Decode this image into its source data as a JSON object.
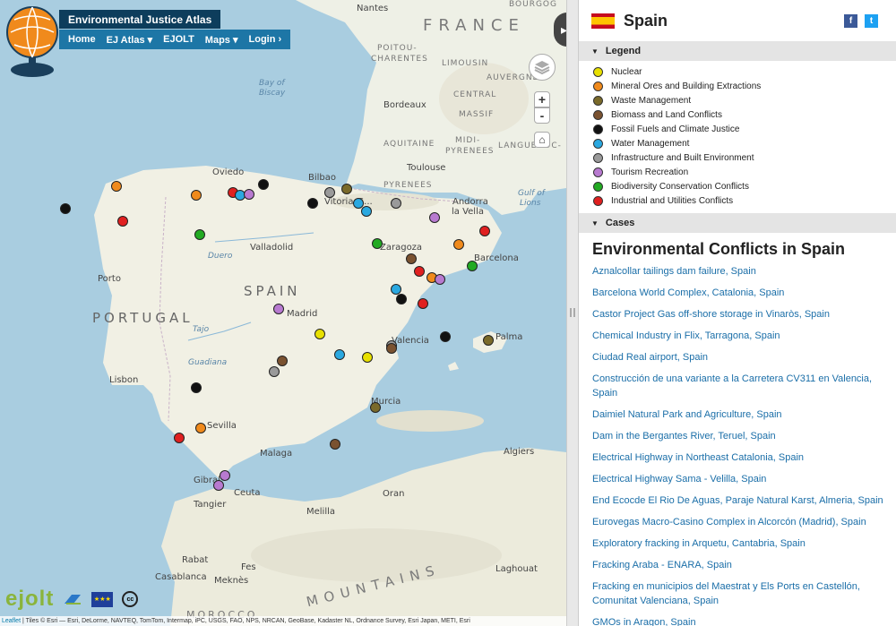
{
  "header": {
    "site_title": "Environmental Justice Atlas",
    "nav": [
      "Home",
      "EJ Atlas ▾",
      "EJOLT",
      "Maps ▾",
      "Login ›"
    ]
  },
  "map": {
    "labels": {
      "nantes": "Nantes",
      "france": "FRANCE",
      "poitou": "POITOU-",
      "charentes": "CHARENTES",
      "limousin": "LIMOUSIN",
      "auvergne": "AUVERGNE",
      "bay": "Bay of",
      "biscay": "Biscay",
      "central": "CENTRAL",
      "massif": "MASSIF",
      "bordeaux": "Bordeaux",
      "aquitaine": "AQUITAINE",
      "midi": "MIDI-",
      "pyrenees_r": "PYRENEES",
      "languedoc": "LANGUEDOC-",
      "toulouse": "Toulouse",
      "oviedo": "Oviedo",
      "bilbao": "Bilbao",
      "vitoria": "Vitoria-G...",
      "pyrenees": "PYRENEES",
      "andorra": "Andorra",
      "la_vella": "la Vella",
      "gulf": "Gulf of",
      "lions": "Lions",
      "zaragoza": "Zaragoza",
      "valladolid": "Valladolid",
      "barcelona": "Barcelona",
      "duero": "Duero",
      "porto": "Porto",
      "spain": "SPAIN",
      "portugal": "PORTUGAL",
      "madrid": "Madrid",
      "tajo": "Tajo",
      "valencia": "Valencia",
      "lisbon": "Lisbon",
      "guadiana": "Guadiana",
      "palma": "Palma",
      "murcia": "Murcia",
      "sevilla": "Sevilla",
      "malaga": "Malaga",
      "algiers": "Algiers",
      "gibraltar": "Gibral",
      "ceuta": "Ceuta",
      "tangier": "Tangier",
      "oran": "Oran",
      "melilla": "Melilla",
      "rabat": "Rabat",
      "fes": "Fes",
      "casablanca": "Casablanca",
      "meknes": "Meknès",
      "laghouat": "Laghouat",
      "morocco": "MOROCCO",
      "mountains": "MOUNTAINS",
      "bourges": "BOURGOG"
    },
    "controls": {
      "zoom_in": "+",
      "zoom_out": "-",
      "home": "⌂",
      "collapse": "▸▸"
    },
    "attribution_link": "Leaflet",
    "attribution_text": " | Tiles © Esri — Esri, DeLorme, NAVTEQ, TomTom, Intermap, iPC, USGS, FAO, NPS, NRCAN, GeoBase, Kadaster NL, Ordnance Survey, Esri Japan, METI, Esri",
    "footer_logo": "ejolt",
    "cc_label": "cc",
    "eu_label": "★★★"
  },
  "panel": {
    "country": "Spain",
    "social": {
      "facebook": "f",
      "twitter": "t"
    },
    "legend_title": "Legend",
    "legend": [
      {
        "label": "Nuclear",
        "color": "#e8e000"
      },
      {
        "label": "Mineral Ores and Building Extractions",
        "color": "#f08a1c"
      },
      {
        "label": "Waste Management",
        "color": "#7a6a2a"
      },
      {
        "label": "Biomass and Land Conflicts",
        "color": "#7a5230"
      },
      {
        "label": "Fossil Fuels and Climate Justice",
        "color": "#111111"
      },
      {
        "label": "Water Management",
        "color": "#2aa8e0"
      },
      {
        "label": "Infrastructure and Built Environment",
        "color": "#9a9a9a"
      },
      {
        "label": "Tourism Recreation",
        "color": "#b87ad0"
      },
      {
        "label": "Biodiversity Conservation Conflicts",
        "color": "#22aa22"
      },
      {
        "label": "Industrial and Utilities Conflicts",
        "color": "#e02020"
      }
    ],
    "cases_title": "Cases",
    "cases_heading": "Environmental Conflicts in Spain",
    "cases": [
      "Aznalcollar tailings dam failure, Spain",
      "Barcelona World Complex, Catalonia, Spain",
      "Castor Project Gas off-shore storage in Vinaròs, Spain",
      "Chemical Industry in Flix, Tarragona, Spain",
      "Ciudad Real airport, Spain",
      "Construcción de una variante a la Carretera CV311 en Valencia, Spain",
      "Daimiel Natural Park and Agriculture, Spain",
      "Dam in the Bergantes River, Teruel, Spain",
      "Electrical Highway in Northeast Catalonia, Spain",
      "Electrical Highway Sama - Velilla, Spain",
      "End Ecocde El Rio De Aguas, Paraje Natural Karst, Almeria, Spain",
      "Eurovegas Macro-Casino Complex in Alcorcón (Madrid), Spain",
      "Exploratory fracking in Arquetu, Cantabria, Spain",
      "Fracking Araba - ENARA, Spain",
      "Fracking en municipios del Maestrat y Els Ports en Castellón, Comunitat Valenciana, Spain",
      "GMOs in Aragon, Spain"
    ]
  }
}
